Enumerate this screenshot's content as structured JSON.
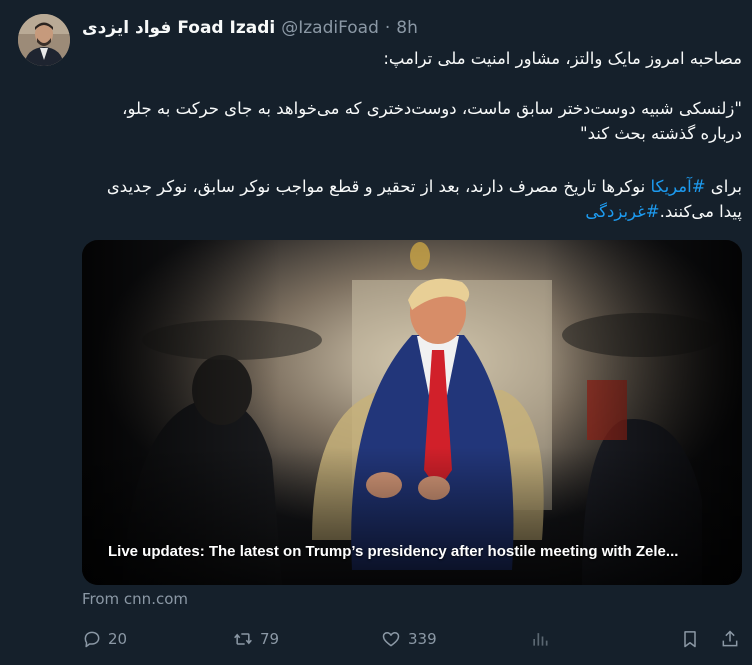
{
  "author": {
    "name": "فواد ایزدی",
    "name_latin": "Foad Izadi",
    "handle": "@IzadiFoad",
    "separator": "·",
    "time": "8h"
  },
  "tweet": {
    "line1": "مصاحبه امروز مایک والتز، مشاور امنیت ملی ترامپ:",
    "quote": "\"زلنسکی شبیه دوست‌دختر سابق ماست، دوست‌دختری که می‌خواهد به جای حرکت به جلو، درباره گذشته بحث کند\"",
    "p3_before": "برای ",
    "p3_tag1": "#آمریکا",
    "p3_middle": " نوکرها تاریخ مصرف دارند، بعد از تحقیر و قطع مواجب نوکر سابق، نوکر جدیدی پیدا می‌کنند.",
    "p3_tag2": "#غربزدگی"
  },
  "card": {
    "headline": "Live updates: The latest on Trump’s presidency after hostile meeting with Zele...",
    "source": "From cnn.com"
  },
  "actions": {
    "replies": "20",
    "reposts": "79",
    "likes": "339"
  },
  "colors": {
    "background": "#15202b",
    "text": "#f7f9f9",
    "muted": "#8b98a5",
    "link": "#1d9bf0"
  }
}
